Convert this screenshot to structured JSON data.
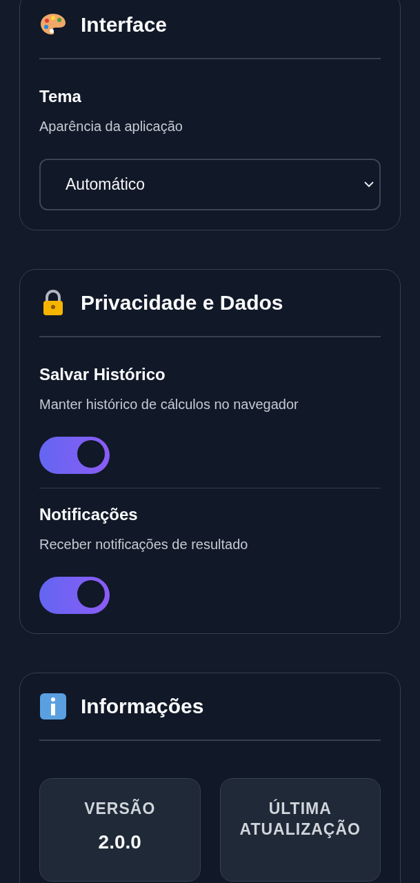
{
  "sections": [
    {
      "title": "Interface",
      "settings": [
        {
          "kind": "select",
          "label": "Tema",
          "description": "Aparência da aplicação",
          "value": "Automático"
        }
      ]
    },
    {
      "title": "Privacidade e Dados",
      "settings": [
        {
          "kind": "toggle",
          "label": "Salvar Histórico",
          "description": "Manter histórico de cálculos no navegador",
          "on": true
        },
        {
          "kind": "toggle",
          "label": "Notificações",
          "description": "Receber notificações de resultado",
          "on": true
        }
      ]
    },
    {
      "title": "Informações",
      "info_cards": [
        {
          "label": "VERSÃO",
          "value": "2.0.0"
        },
        {
          "label": "ÚLTIMA ATUALIZAÇÃO"
        }
      ]
    }
  ]
}
